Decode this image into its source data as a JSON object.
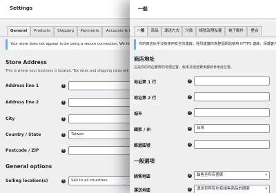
{
  "en": {
    "page_title": "Settings",
    "tabs": [
      {
        "label": "General",
        "active": true
      },
      {
        "label": "Products"
      },
      {
        "label": "Shipping"
      },
      {
        "label": "Payments"
      },
      {
        "label": "Accounts & Pr"
      }
    ],
    "notice": "Your store does not appear to be using a secure connection. We highly rec",
    "store_address": {
      "heading": "Store Address",
      "description": "This is where your business is located. Tax rates and shipping rates will use t",
      "fields": [
        {
          "label": "Address line 1",
          "value": ""
        },
        {
          "label": "Address line 2",
          "value": ""
        },
        {
          "label": "City",
          "value": ""
        },
        {
          "label": "Country / State",
          "value": "Taiwan"
        },
        {
          "label": "Postcode / ZIP",
          "value": ""
        }
      ]
    },
    "general_options": {
      "heading": "General options",
      "selling_location_label": "Selling location(s)",
      "selling_location_value": "Sell to all countries"
    }
  },
  "zh": {
    "page_title": "一般",
    "tabs": [
      {
        "label": "一般",
        "active": true
      },
      {
        "label": "商品"
      },
      {
        "label": "運送方式"
      },
      {
        "label": "付款"
      },
      {
        "label": "帳號及隱私權"
      },
      {
        "label": "電子郵件"
      },
      {
        "label": "整合"
      }
    ],
    "notice": "你的商店似乎沒有使用安全的連線，強烈建議你為整個網站使用 HTTPS 連線，保護客戶",
    "store_address": {
      "heading": "商店地址",
      "description": "這是你的商店實際的地理位置，稅率及運送費率都將參考此位置。",
      "fields": [
        {
          "label": "地址第 1 行",
          "value": ""
        },
        {
          "label": "地址第 2 行",
          "value": ""
        },
        {
          "label": "城市",
          "value": ""
        },
        {
          "label": "國家 / 州",
          "value": "台灣"
        },
        {
          "label": "郵遞區號",
          "value": ""
        }
      ]
    },
    "general_options": {
      "heading": "一般選項",
      "selling_location_label": "銷售地區",
      "selling_location_value": "銷售至所有國家",
      "shipping_location_label": "運送地區",
      "shipping_location_value": "運送至所有你有銷售商品的國家"
    }
  },
  "icons": {
    "help": "?",
    "chevron": "▾"
  }
}
